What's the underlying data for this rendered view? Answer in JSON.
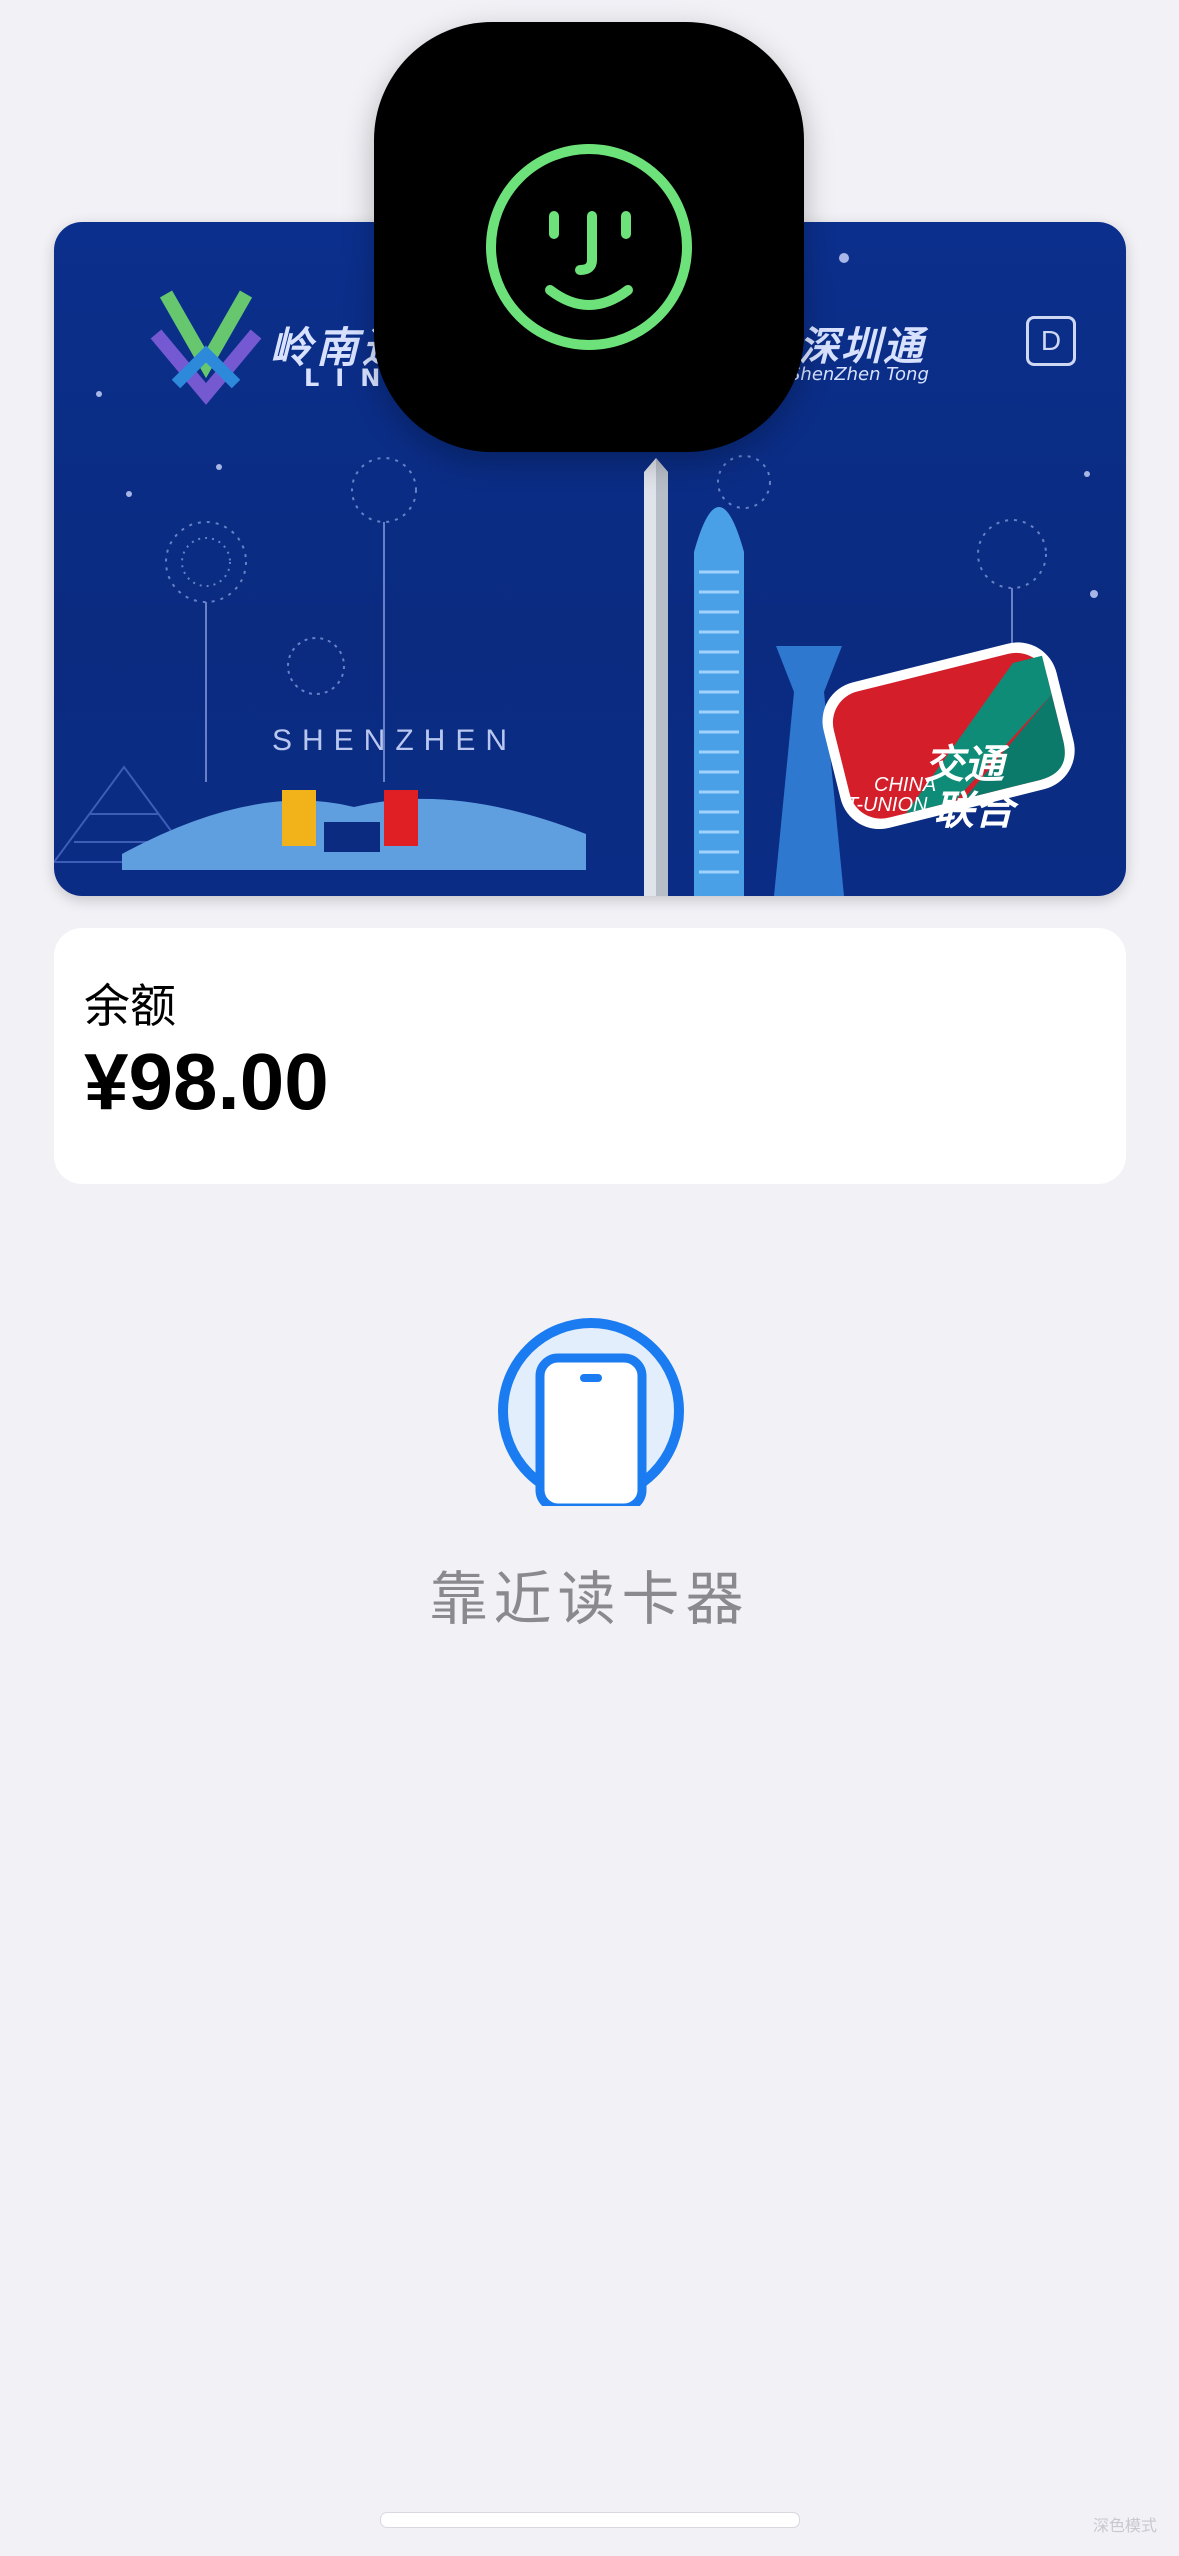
{
  "card": {
    "issuer_left": "岭南通",
    "issuer_left_sub": "LINGNAN",
    "issuer_right": "深圳通",
    "issuer_right_sub": "ShenZhen Tong",
    "badge": "D",
    "city": "SHENZHEN",
    "tunion_cn_top": "交通",
    "tunion_cn_bottom": "联合",
    "tunion_en_top": "CHINA",
    "tunion_en_bottom": "T-UNION"
  },
  "faceid": {
    "icon": "face-id-icon"
  },
  "balance": {
    "label": "余额",
    "value": "¥98.00"
  },
  "reader": {
    "icon": "phone-icon",
    "prompt": "靠近读卡器"
  },
  "watermark": "深色模式",
  "colors": {
    "background": "#f1f1f6",
    "card_blue": "#0b2f8c",
    "faceid_green": "#6ee27a",
    "reader_blue": "#1a7cf0",
    "prompt_gray": "#8a8a8e"
  }
}
